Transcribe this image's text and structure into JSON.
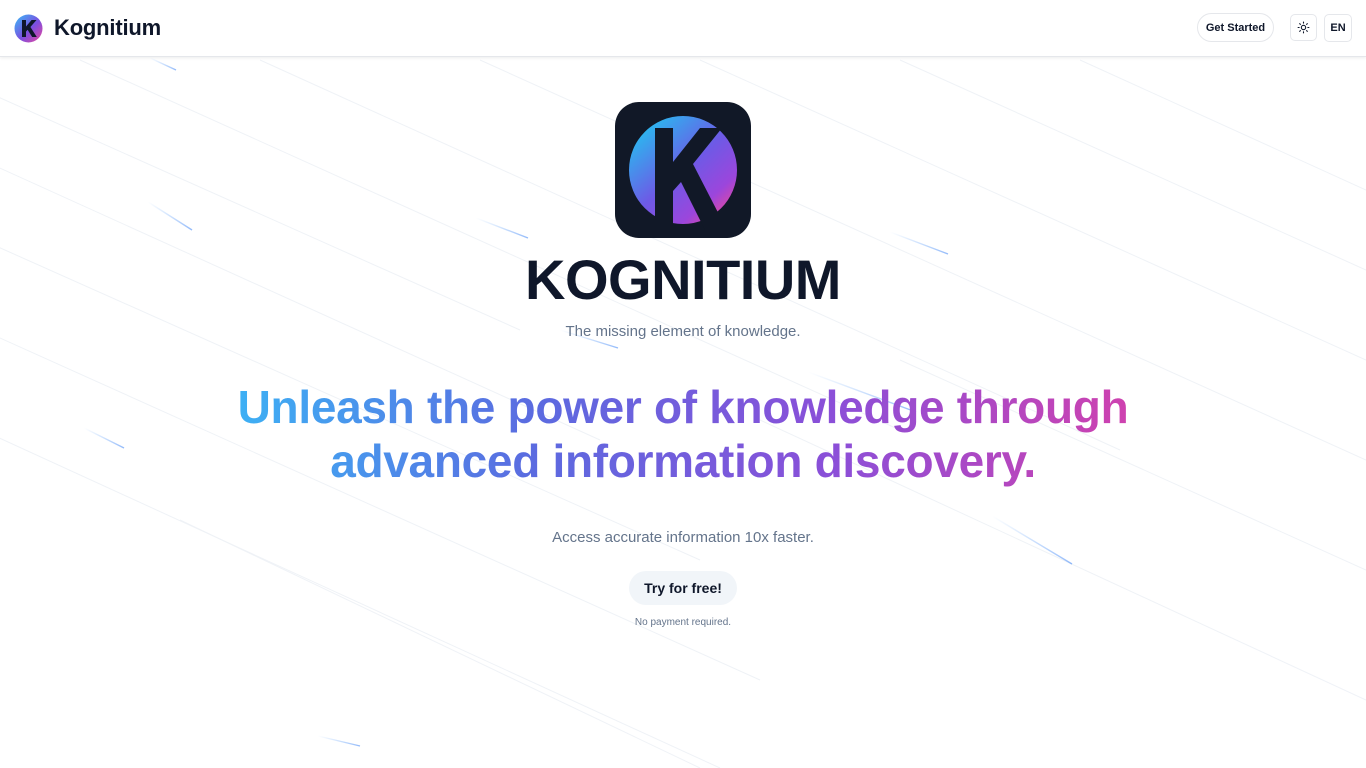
{
  "navbar": {
    "brand_name": "Kognitium",
    "get_started_label": "Get Started",
    "theme_icon": "sun-icon",
    "language_label": "EN"
  },
  "hero": {
    "logo_icon": "kognitium-logo-icon",
    "title": "KOGNITIUM",
    "tagline": "The missing element of knowledge.",
    "headline": "Unleash the power of knowledge through advanced information discovery.",
    "subtext": "Access accurate information 10x faster.",
    "cta_label": "Try for free!",
    "cta_note": "No payment required."
  },
  "colors": {
    "text_dark": "#0f172a",
    "text_muted": "#64748b",
    "gradient_start": "#38bdf8",
    "gradient_mid": "#8b4fd8",
    "gradient_end": "#db3fa8",
    "logo_bg": "#111827",
    "button_bg": "#f1f5f9"
  }
}
